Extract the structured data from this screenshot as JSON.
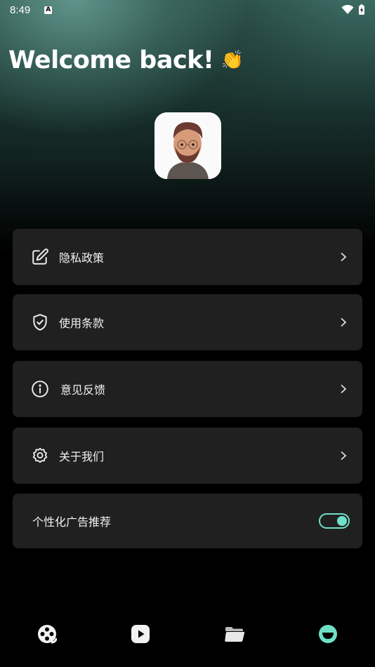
{
  "status_bar": {
    "time": "8:49",
    "icons": [
      "notification-a-icon",
      "wifi-icon",
      "battery-charging-icon"
    ]
  },
  "header": {
    "welcome": "Welcome back!",
    "emoji": "👏",
    "avatar": "memoji-avatar"
  },
  "menu": {
    "items": [
      {
        "label": "隐私政策",
        "icon": "edit-icon"
      },
      {
        "label": "使用条款",
        "icon": "shield-check-icon"
      },
      {
        "label": "意见反馈",
        "icon": "info-icon"
      },
      {
        "label": "关于我们",
        "icon": "gear-icon"
      }
    ],
    "toggle": {
      "label": "个性化广告推荐",
      "enabled": true
    }
  },
  "bottom_nav": {
    "items": [
      {
        "icon": "film-reel-icon"
      },
      {
        "icon": "play-icon"
      },
      {
        "icon": "folder-icon"
      },
      {
        "icon": "profile-smile-icon",
        "active": true
      }
    ]
  },
  "colors": {
    "accent": "#6fe0c8",
    "card": "#202020",
    "background": "#000000"
  }
}
